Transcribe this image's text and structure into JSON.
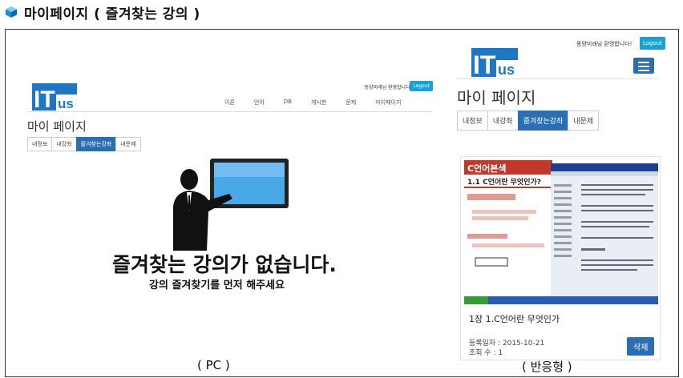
{
  "heading": {
    "text": "마이페이지 ( 즐겨찾는 강의 )",
    "icon": "cube-icon"
  },
  "pc": {
    "logo": {
      "text_it": "IT",
      "text_us": "us"
    },
    "welcome": "동양미래님 환영합니다!",
    "logout_label": "Logout",
    "nav": [
      "이론",
      "언어",
      "DB",
      "게시판",
      "문제",
      "마이페이지"
    ],
    "page_title": "마이 페이지",
    "tabs": [
      {
        "label": "내정보",
        "active": false
      },
      {
        "label": "내강좌",
        "active": false
      },
      {
        "label": "즐겨찾는강좌",
        "active": true
      },
      {
        "label": "내문제",
        "active": false
      }
    ],
    "empty_title": "즐겨찾는 강의가 없습니다.",
    "empty_subtitle": "강의 즐겨찾기를 먼저 해주세요"
  },
  "mobile": {
    "welcome": "동양미래님 환영합니다!",
    "logout_label": "Logout",
    "logo": {
      "text_it": "IT",
      "text_us": "us"
    },
    "page_title": "마이 페이지",
    "tabs": [
      {
        "label": "내정보",
        "active": false
      },
      {
        "label": "내강좌",
        "active": false
      },
      {
        "label": "즐겨찾는강좌",
        "active": true
      },
      {
        "label": "내문제",
        "active": false
      }
    ],
    "course": {
      "thumb_heading": "C언어본색",
      "thumb_sub": "1.1 C언어란 무엇인가?",
      "title": "1장 1.C언어란 무엇인가",
      "date": "등록일자 : 2015-10-21",
      "views": "조회 수 : 1",
      "delete_label": "삭제"
    }
  },
  "captions": {
    "pc": "( PC )",
    "mobile": "( 반응형 )"
  },
  "colors": {
    "accent": "#2a6fb3",
    "logout": "#17a2d4"
  }
}
